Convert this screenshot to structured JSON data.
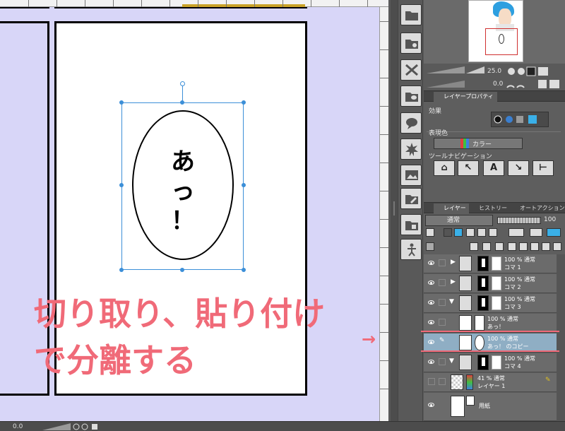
{
  "canvas": {
    "balloon_text_line1": "あっ",
    "balloon_text_line2": "！"
  },
  "navigator": {
    "zoom_value": "25.0",
    "rotate_value": "0.0"
  },
  "tabs": {
    "layer_property": "レイヤープロパティ",
    "layer": "レイヤー",
    "history": "ヒストリー",
    "auto_action": "オートアクション"
  },
  "layer_property": {
    "effect_label": "効果",
    "expression_color_label": "表現色",
    "expression_color_value": "カラー",
    "tool_navigation_label": "ツールナビゲーション"
  },
  "layer_panel": {
    "blend_mode": "通常",
    "opacity": "100"
  },
  "layers": [
    {
      "blend": "100 % 通常",
      "name": "コマ 1"
    },
    {
      "blend": "100 % 通常",
      "name": "コマ 2"
    },
    {
      "blend": "100 % 通常",
      "name": "コマ 3"
    },
    {
      "blend": "100 % 通常",
      "name": "あっ！"
    },
    {
      "blend": "100 % 通常",
      "name": "あっ！ のコピー"
    },
    {
      "blend": "100 % 通常",
      "name": "コマ 4"
    },
    {
      "blend": "41 % 通常",
      "name": "レイヤー 1"
    },
    {
      "blend": "",
      "name": "用紙"
    }
  ],
  "status": {
    "zoom": "0.0"
  },
  "annotation": {
    "line1": "切り取り、貼り付け",
    "line2": "で分離する",
    "arrow": "→"
  },
  "colors": {
    "canvas_bg": "#d8d6f8",
    "selection": "#3c8fd8",
    "annotation": "#f06a78",
    "selected_layer": "#8faec4"
  }
}
